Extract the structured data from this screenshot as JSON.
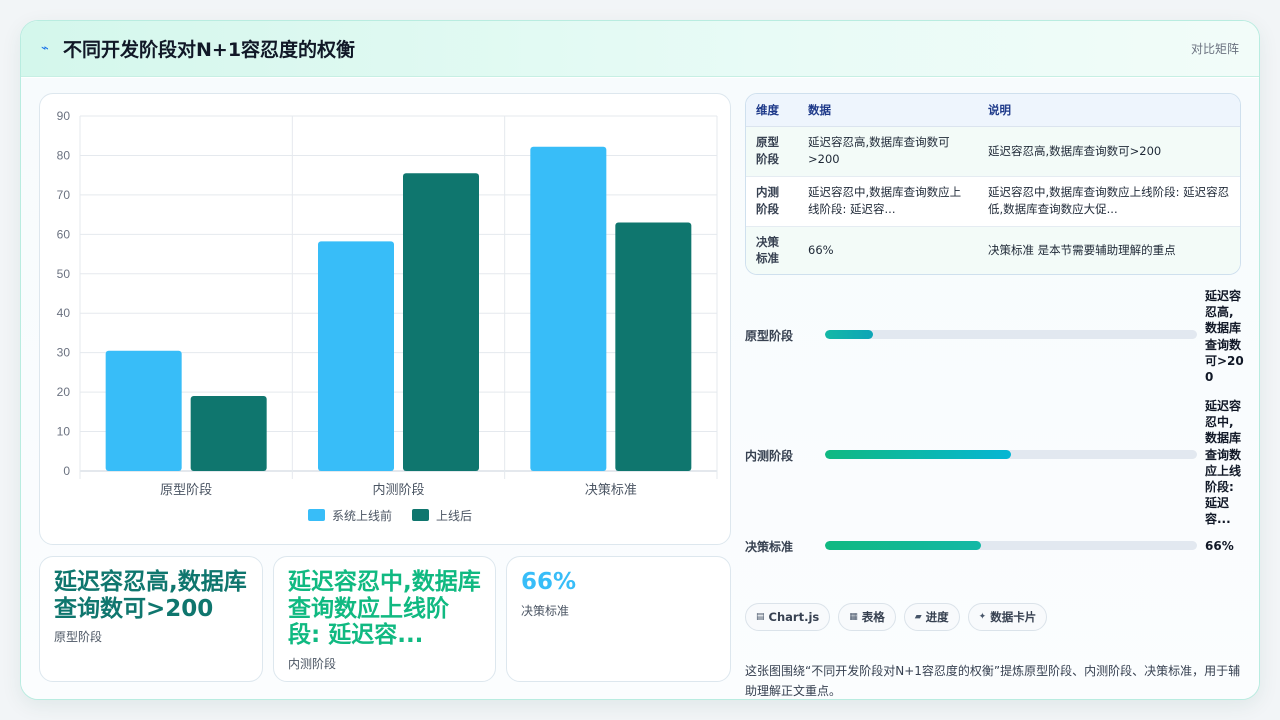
{
  "header": {
    "icon": "lightning-icon",
    "title": "不同开发阶段对N+1容忍度的权衡",
    "right_label": "对比矩阵"
  },
  "chart_data": {
    "type": "bar",
    "categories": [
      "原型阶段",
      "内测阶段",
      "决策标准"
    ],
    "series": [
      {
        "name": "系统上线前",
        "values": [
          30.5,
          58.2,
          82.2
        ],
        "color": "#38bdf8"
      },
      {
        "name": "上线后",
        "values": [
          19.0,
          75.5,
          63.0
        ],
        "color": "#0f766e"
      }
    ],
    "ylim": [
      0,
      90
    ],
    "yticks": [
      0,
      10,
      20,
      30,
      40,
      50,
      60,
      70,
      80,
      90
    ],
    "grid": true,
    "legend_position": "bottom"
  },
  "stats": [
    {
      "value": "延迟容忍高,数据库查询数可>200",
      "label": "原型阶段",
      "color": "#0f766e"
    },
    {
      "value": "延迟容忍中,数据库查询数应上线阶段: 延迟容...",
      "label": "内测阶段",
      "color": "#10b981"
    },
    {
      "value": "66%",
      "label": "决策标准",
      "color": "#38bdf8"
    }
  ],
  "table": {
    "headers": [
      "维度",
      "数据",
      "说明"
    ],
    "rows": [
      {
        "dim": "原型阶段",
        "data": "延迟容忍高,数据库查询数可>200",
        "note": "延迟容忍高,数据库查询数可>200"
      },
      {
        "dim": "内测阶段",
        "data": "延迟容忍中,数据库查询数应上线阶段: 延迟容...",
        "note": "延迟容忍中,数据库查询数应上线阶段: 延迟容忍低,数据库查询数应大促..."
      },
      {
        "dim": "决策标准",
        "data": "66%",
        "note": "决策标准 是本节需要辅助理解的重点"
      }
    ]
  },
  "progress": [
    {
      "label": "原型阶段",
      "value_text": "延迟容忍高,数据库查询数可>200",
      "fraction": 0.13
    },
    {
      "label": "内测阶段",
      "value_text": "延迟容忍中,数据库查询数应上线阶段: 延迟容...",
      "fraction": 0.5
    },
    {
      "label": "决策标准",
      "value_text": "66%",
      "fraction": 0.42
    }
  ],
  "chips": [
    {
      "icon": "chart-icon",
      "label": "Chart.js"
    },
    {
      "icon": "table-icon",
      "label": "表格"
    },
    {
      "icon": "progress-icon",
      "label": "进度"
    },
    {
      "icon": "sparkle-icon",
      "label": "数据卡片"
    }
  ],
  "footnote": "这张图围绕“不同开发阶段对N+1容忍度的权衡”提炼原型阶段、内测阶段、决策标准，用于辅助理解正文重点。"
}
